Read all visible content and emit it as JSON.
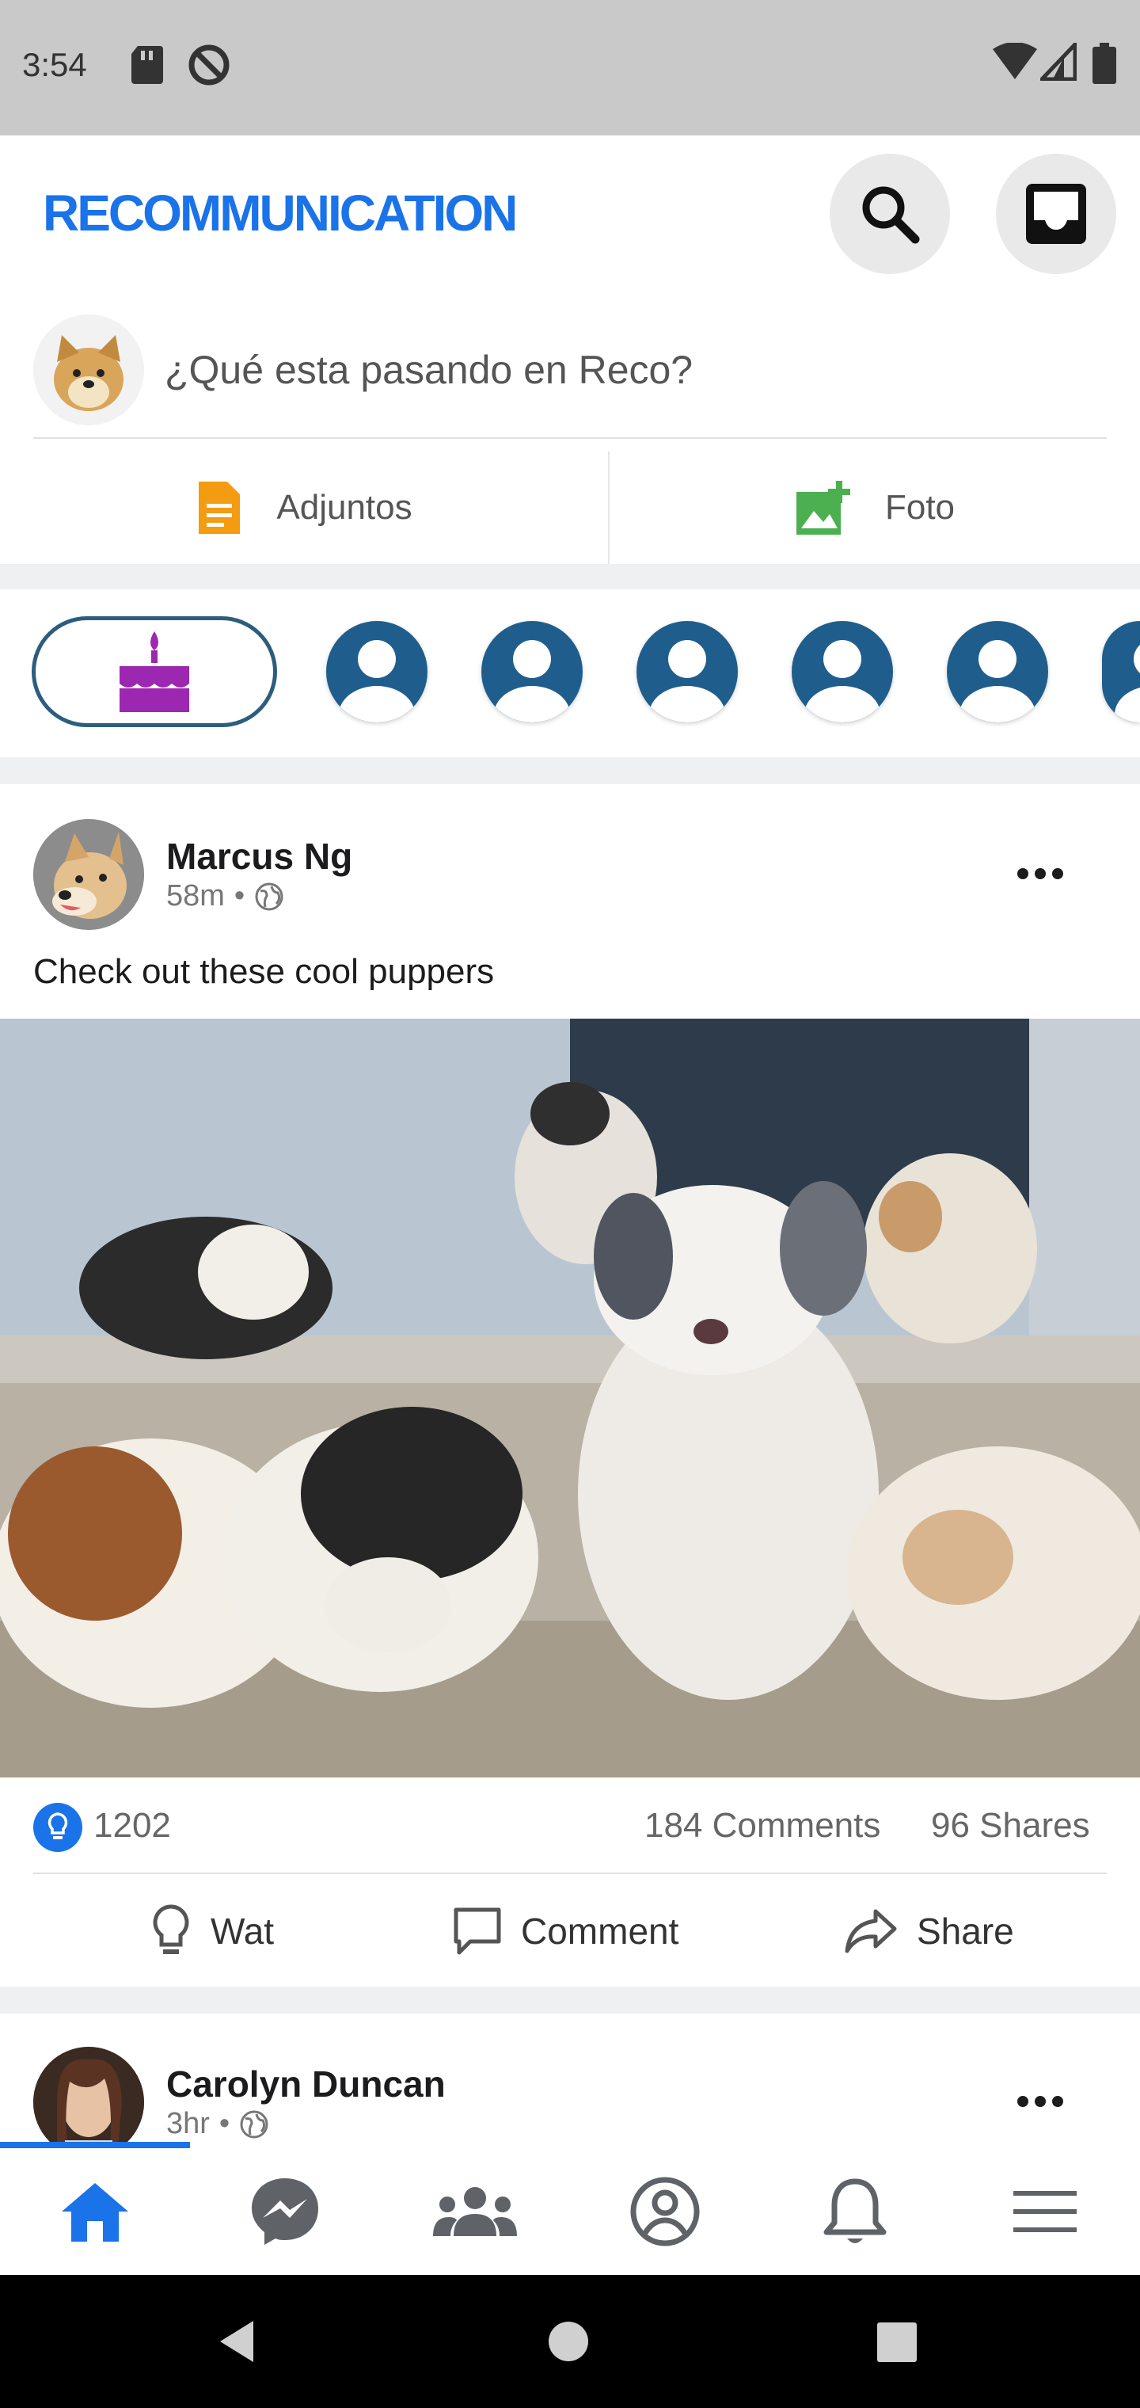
{
  "status_bar": {
    "time": "3:54"
  },
  "header": {
    "title": "RECOMMUNICATION"
  },
  "composer": {
    "placeholder": "¿Qué esta pasando en Reco?",
    "attach_label": "Adjuntos",
    "photo_label": "Foto"
  },
  "post": {
    "author": "Marcus Ng",
    "time": "58m",
    "text": "Check out these cool puppers",
    "likes": "1202",
    "comments": "184 Comments",
    "shares": "96 Shares",
    "action_like": "Wat",
    "action_comment": "Comment",
    "action_share": "Share"
  },
  "next_post": {
    "author": "Carolyn Duncan",
    "time": "3hr"
  },
  "colors": {
    "brand": "#1a73e8",
    "story": "#1f5e8c",
    "birthday": "#9c27b0",
    "attach": "#f39c12",
    "photo": "#4caf50"
  }
}
